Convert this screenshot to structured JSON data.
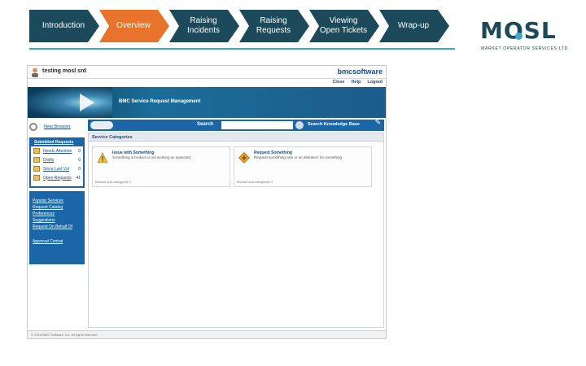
{
  "nav": {
    "steps": [
      {
        "label": "Introduction"
      },
      {
        "label": "Overview"
      },
      {
        "label": "Raising Incidents"
      },
      {
        "label": "Raising Requests"
      },
      {
        "label": "Viewing Open Tickets"
      },
      {
        "label": "Wrap-up"
      }
    ],
    "active_color": "#e8732a",
    "inactive_color": "#1c4a5a"
  },
  "logo": {
    "word": "MOSL",
    "subtitle": "MARKET OPERATOR SERVICES LTD"
  },
  "app": {
    "user_name": "testing mosl srd",
    "vendor_logo": "bmcsoftware",
    "top_links": [
      "Close",
      "Help",
      "Logout"
    ],
    "banner_title": "BMC Service Request Management",
    "new_browser_label": "New Browser",
    "submitted_requests": {
      "title": "Submitted Requests",
      "items": [
        {
          "label": "Needs Attention",
          "count": "0"
        },
        {
          "label": "Drafts",
          "count": "0"
        },
        {
          "label": "Since Last Vst",
          "count": "0"
        },
        {
          "label": "Open Requests",
          "count": "41"
        }
      ]
    },
    "side_links": [
      "Popular Services",
      "Request Catalog",
      "Preferences",
      "Suggestions",
      "Request On Behalf Of"
    ],
    "side_link_bottom": "Approval Central",
    "search_label": "Search",
    "search_value": "",
    "kb_label": "Search Knowledge Base",
    "main_heading": "Service Categories",
    "cards": [
      {
        "title": "Issue with Something",
        "desc": "Something is broken or not working as expected",
        "foot": "Browse sub-categories »",
        "icon": "warning-icon"
      },
      {
        "title": "Request Something",
        "desc": "Request something new or an alteration for something",
        "foot": "Browse sub-categories »",
        "icon": "request-icon"
      }
    ],
    "footer": "© 2016 BMC Software, Inc. All rights reserved."
  }
}
